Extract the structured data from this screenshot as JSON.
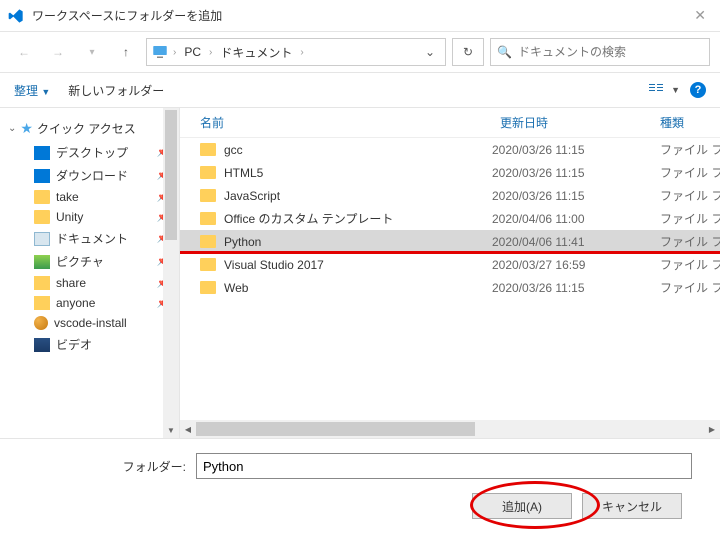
{
  "window": {
    "title": "ワークスペースにフォルダーを追加"
  },
  "breadcrumb": {
    "pc": "PC",
    "folder": "ドキュメント"
  },
  "search": {
    "placeholder": "ドキュメントの検索"
  },
  "toolbar": {
    "organize": "整理",
    "newfolder": "新しいフォルダー"
  },
  "sidebar": {
    "quickaccess": "クイック アクセス",
    "items": [
      {
        "label": "デスクトップ",
        "icon": "desktop",
        "pinned": true
      },
      {
        "label": "ダウンロード",
        "icon": "download",
        "pinned": true
      },
      {
        "label": "take",
        "icon": "folder",
        "pinned": true
      },
      {
        "label": "Unity",
        "icon": "folder",
        "pinned": true
      },
      {
        "label": "ドキュメント",
        "icon": "doc",
        "pinned": true
      },
      {
        "label": "ピクチャ",
        "icon": "pic",
        "pinned": true
      },
      {
        "label": "share",
        "icon": "share",
        "pinned": true
      },
      {
        "label": "anyone",
        "icon": "anyone",
        "pinned": true
      },
      {
        "label": "vscode-install",
        "icon": "ball",
        "pinned": false
      },
      {
        "label": "ビデオ",
        "icon": "video",
        "pinned": false
      }
    ]
  },
  "columns": {
    "name": "名前",
    "date": "更新日時",
    "type": "種類"
  },
  "files": [
    {
      "name": "gcc",
      "date": "2020/03/26 11:15",
      "type": "ファイル フ",
      "selected": false
    },
    {
      "name": "HTML5",
      "date": "2020/03/26 11:15",
      "type": "ファイル フ",
      "selected": false
    },
    {
      "name": "JavaScript",
      "date": "2020/03/26 11:15",
      "type": "ファイル フ",
      "selected": false
    },
    {
      "name": "Office のカスタム テンプレート",
      "date": "2020/04/06 11:00",
      "type": "ファイル フ",
      "selected": false
    },
    {
      "name": "Python",
      "date": "2020/04/06 11:41",
      "type": "ファイル フ",
      "selected": true
    },
    {
      "name": "Visual Studio 2017",
      "date": "2020/03/27 16:59",
      "type": "ファイル フ",
      "selected": false
    },
    {
      "name": "Web",
      "date": "2020/03/26 11:15",
      "type": "ファイル フ",
      "selected": false
    }
  ],
  "folder": {
    "label": "フォルダー:",
    "value": "Python"
  },
  "buttons": {
    "add": "追加(A)",
    "cancel": "キャンセル"
  }
}
